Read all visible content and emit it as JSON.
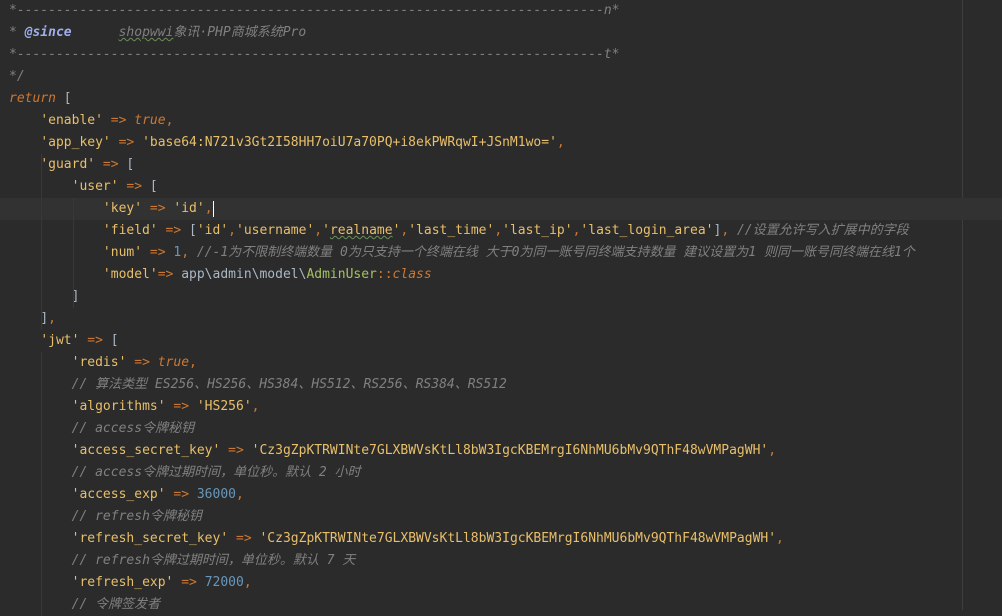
{
  "editor": {
    "lines": [
      {
        "current": false,
        "tokens": [
          {
            "c": "t-comment",
            "t": "*---------------------------------------------------------------------------n*"
          }
        ]
      },
      {
        "current": false,
        "tokens": [
          {
            "c": "t-comment",
            "t": "* "
          },
          {
            "c": "t-tag",
            "t": "@since"
          },
          {
            "c": "t-comment",
            "t": "      "
          },
          {
            "c": "t-comment squig",
            "t": "shopwwi"
          },
          {
            "c": "t-comment",
            "t": "象讯·PHP商城系统Pro"
          }
        ]
      },
      {
        "current": false,
        "tokens": [
          {
            "c": "t-comment",
            "t": "*---------------------------------------------------------------------------t*"
          }
        ]
      },
      {
        "current": false,
        "tokens": [
          {
            "c": "t-comment",
            "t": "*/"
          }
        ]
      },
      {
        "current": false,
        "tokens": [
          {
            "c": "t-kw",
            "t": "return"
          },
          {
            "c": "t-punc",
            "t": " ["
          }
        ]
      },
      {
        "current": false,
        "tokens": [
          {
            "c": "t-plain",
            "t": "    "
          },
          {
            "c": "t-str",
            "t": "'enable'"
          },
          {
            "c": "t-op",
            "t": " => "
          },
          {
            "c": "t-bool",
            "t": "true"
          },
          {
            "c": "t-op",
            "t": ","
          }
        ]
      },
      {
        "current": false,
        "tokens": [
          {
            "c": "t-plain",
            "t": "    "
          },
          {
            "c": "t-str",
            "t": "'app_key'"
          },
          {
            "c": "t-op",
            "t": " => "
          },
          {
            "c": "t-str",
            "t": "'base64:N721v3Gt2I58HH7oiU7a70PQ+i8ekPWRqwI+JSnM1wo='"
          },
          {
            "c": "t-op",
            "t": ","
          }
        ]
      },
      {
        "current": false,
        "tokens": [
          {
            "c": "t-plain",
            "t": "    "
          },
          {
            "c": "t-str",
            "t": "'guard'"
          },
          {
            "c": "t-op",
            "t": " => "
          },
          {
            "c": "t-punc",
            "t": "["
          }
        ]
      },
      {
        "current": false,
        "tokens": [
          {
            "c": "t-plain",
            "t": "        "
          },
          {
            "c": "t-str",
            "t": "'user'"
          },
          {
            "c": "t-op",
            "t": " => "
          },
          {
            "c": "t-punc",
            "t": "["
          }
        ]
      },
      {
        "current": true,
        "tokens": [
          {
            "c": "t-plain",
            "t": "            "
          },
          {
            "c": "t-str",
            "t": "'key'"
          },
          {
            "c": "t-op",
            "t": " => "
          },
          {
            "c": "t-str",
            "t": "'id'"
          },
          {
            "c": "t-op",
            "t": ","
          },
          {
            "c": "caret",
            "t": ""
          }
        ]
      },
      {
        "current": false,
        "tokens": [
          {
            "c": "t-plain",
            "t": "            "
          },
          {
            "c": "t-str",
            "t": "'field'"
          },
          {
            "c": "t-op",
            "t": " => "
          },
          {
            "c": "t-punc",
            "t": "["
          },
          {
            "c": "t-str",
            "t": "'id'"
          },
          {
            "c": "t-op",
            "t": ","
          },
          {
            "c": "t-str",
            "t": "'username'"
          },
          {
            "c": "t-op",
            "t": ","
          },
          {
            "c": "t-str",
            "t": "'"
          },
          {
            "c": "t-str squig",
            "t": "realname"
          },
          {
            "c": "t-str",
            "t": "'"
          },
          {
            "c": "t-op",
            "t": ","
          },
          {
            "c": "t-str",
            "t": "'last_time'"
          },
          {
            "c": "t-op",
            "t": ","
          },
          {
            "c": "t-str",
            "t": "'last_ip'"
          },
          {
            "c": "t-op",
            "t": ","
          },
          {
            "c": "t-str",
            "t": "'last_login_area'"
          },
          {
            "c": "t-punc",
            "t": "]"
          },
          {
            "c": "t-op",
            "t": ", "
          },
          {
            "c": "t-comment",
            "t": "//设置允许写入扩展中的字段"
          }
        ]
      },
      {
        "current": false,
        "tokens": [
          {
            "c": "t-plain",
            "t": "            "
          },
          {
            "c": "t-str",
            "t": "'num'"
          },
          {
            "c": "t-op",
            "t": " => "
          },
          {
            "c": "t-num",
            "t": "1"
          },
          {
            "c": "t-op",
            "t": ", "
          },
          {
            "c": "t-comment",
            "t": "//-1为不限制终端数量 0为只支持一个终端在线 大于0为同一账号同终端支持数量 建议设置为1 则同一账号同终端在线1个"
          }
        ]
      },
      {
        "current": false,
        "tokens": [
          {
            "c": "t-plain",
            "t": "            "
          },
          {
            "c": "t-str",
            "t": "'model'"
          },
          {
            "c": "t-op",
            "t": "=> "
          },
          {
            "c": "t-plain",
            "t": "app\\admin\\model\\"
          },
          {
            "c": "t-class",
            "t": "AdminUser"
          },
          {
            "c": "t-dblcolon",
            "t": "::"
          },
          {
            "c": "t-classkw",
            "t": "class"
          }
        ]
      },
      {
        "current": false,
        "tokens": [
          {
            "c": "t-plain",
            "t": "        "
          },
          {
            "c": "t-punc",
            "t": "]"
          }
        ]
      },
      {
        "current": false,
        "tokens": [
          {
            "c": "t-plain",
            "t": "    "
          },
          {
            "c": "t-punc",
            "t": "]"
          },
          {
            "c": "t-op",
            "t": ","
          }
        ]
      },
      {
        "current": false,
        "tokens": [
          {
            "c": "t-plain",
            "t": "    "
          },
          {
            "c": "t-str",
            "t": "'jwt'"
          },
          {
            "c": "t-op",
            "t": " => "
          },
          {
            "c": "t-punc",
            "t": "["
          }
        ]
      },
      {
        "current": false,
        "tokens": [
          {
            "c": "t-plain",
            "t": "        "
          },
          {
            "c": "t-str",
            "t": "'redis'"
          },
          {
            "c": "t-op",
            "t": " => "
          },
          {
            "c": "t-bool",
            "t": "true"
          },
          {
            "c": "t-op",
            "t": ","
          }
        ]
      },
      {
        "current": false,
        "tokens": [
          {
            "c": "t-plain",
            "t": "        "
          },
          {
            "c": "t-comment",
            "t": "// 算法类型 ES256、HS256、HS384、HS512、RS256、RS384、RS512"
          }
        ]
      },
      {
        "current": false,
        "tokens": [
          {
            "c": "t-plain",
            "t": "        "
          },
          {
            "c": "t-str",
            "t": "'algorithms'"
          },
          {
            "c": "t-op",
            "t": " => "
          },
          {
            "c": "t-str",
            "t": "'HS256'"
          },
          {
            "c": "t-op",
            "t": ","
          }
        ]
      },
      {
        "current": false,
        "tokens": [
          {
            "c": "t-plain",
            "t": "        "
          },
          {
            "c": "t-comment",
            "t": "// access令牌秘钥"
          }
        ]
      },
      {
        "current": false,
        "tokens": [
          {
            "c": "t-plain",
            "t": "        "
          },
          {
            "c": "t-str",
            "t": "'access_secret_key'"
          },
          {
            "c": "t-op",
            "t": " => "
          },
          {
            "c": "t-str",
            "t": "'Cz3gZpKTRWINte7GLXBWVsKtLl8bW3IgcKBEMrgI6NhMU6bMv9QThF48wVMPagWH'"
          },
          {
            "c": "t-op",
            "t": ","
          }
        ]
      },
      {
        "current": false,
        "tokens": [
          {
            "c": "t-plain",
            "t": "        "
          },
          {
            "c": "t-comment",
            "t": "// access令牌过期时间，单位秒。默认 2 小时"
          }
        ]
      },
      {
        "current": false,
        "tokens": [
          {
            "c": "t-plain",
            "t": "        "
          },
          {
            "c": "t-str",
            "t": "'access_exp'"
          },
          {
            "c": "t-op",
            "t": " => "
          },
          {
            "c": "t-num",
            "t": "36000"
          },
          {
            "c": "t-op",
            "t": ","
          }
        ]
      },
      {
        "current": false,
        "tokens": [
          {
            "c": "t-plain",
            "t": "        "
          },
          {
            "c": "t-comment",
            "t": "// refresh令牌秘钥"
          }
        ]
      },
      {
        "current": false,
        "tokens": [
          {
            "c": "t-plain",
            "t": "        "
          },
          {
            "c": "t-str",
            "t": "'refresh_secret_key'"
          },
          {
            "c": "t-op",
            "t": " => "
          },
          {
            "c": "t-str",
            "t": "'Cz3gZpKTRWINte7GLXBWVsKtLl8bW3IgcKBEMrgI6NhMU6bMv9QThF48wVMPagWH'"
          },
          {
            "c": "t-op",
            "t": ","
          }
        ]
      },
      {
        "current": false,
        "tokens": [
          {
            "c": "t-plain",
            "t": "        "
          },
          {
            "c": "t-comment",
            "t": "// refresh令牌过期时间，单位秒。默认 7 天"
          }
        ]
      },
      {
        "current": false,
        "tokens": [
          {
            "c": "t-plain",
            "t": "        "
          },
          {
            "c": "t-str",
            "t": "'refresh_exp'"
          },
          {
            "c": "t-op",
            "t": " => "
          },
          {
            "c": "t-num",
            "t": "72000"
          },
          {
            "c": "t-op",
            "t": ","
          }
        ]
      },
      {
        "current": false,
        "tokens": [
          {
            "c": "t-plain",
            "t": "        "
          },
          {
            "c": "t-comment",
            "t": "// 令牌签发者"
          }
        ]
      }
    ]
  }
}
